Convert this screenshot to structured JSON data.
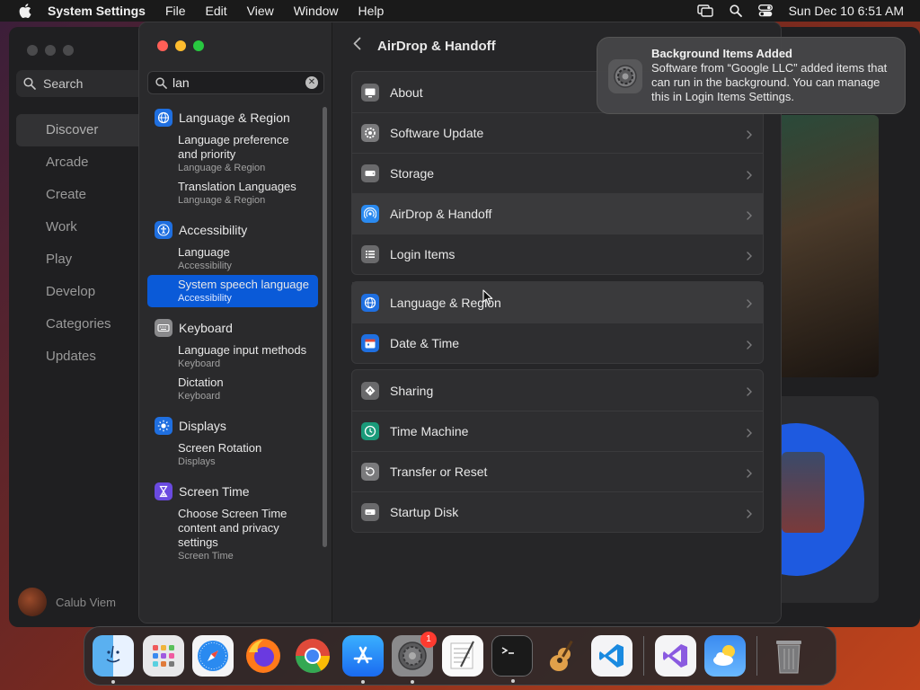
{
  "menubar": {
    "app_name": "System Settings",
    "items": [
      "File",
      "Edit",
      "View",
      "Window",
      "Help"
    ],
    "datetime": "Sun Dec 10  6:51 AM"
  },
  "bg_app": {
    "search_label": "Search",
    "nav": [
      "Discover",
      "Arcade",
      "Create",
      "Work",
      "Play",
      "Develop",
      "Categories",
      "Updates"
    ],
    "user_name": "Calub Viem"
  },
  "sidebar": {
    "search_value": "lan",
    "groups": [
      {
        "label": "Language & Region",
        "icon": "globe-icon",
        "color": "#1f6fe0",
        "subs": [
          {
            "title": "Language preference and priority",
            "source": "Language & Region"
          },
          {
            "title": "Translation Languages",
            "source": "Language & Region"
          }
        ]
      },
      {
        "label": "Accessibility",
        "icon": "accessibility-icon",
        "color": "#1f6fe0",
        "subs": [
          {
            "title": "Language",
            "source": "Accessibility"
          },
          {
            "title": "System speech language",
            "source": "Accessibility",
            "selected": true
          }
        ]
      },
      {
        "label": "Keyboard",
        "icon": "keyboard-icon",
        "color": "#8a8a8c",
        "subs": [
          {
            "title": "Language input methods",
            "source": "Keyboard"
          },
          {
            "title": "Dictation",
            "source": "Keyboard"
          }
        ]
      },
      {
        "label": "Displays",
        "icon": "sun-icon",
        "color": "#1f6fe0",
        "subs": [
          {
            "title": "Screen Rotation",
            "source": "Displays"
          }
        ]
      },
      {
        "label": "Screen Time",
        "icon": "hourglass-icon",
        "color": "#6a4ae0",
        "subs": [
          {
            "title": "Choose Screen Time content and privacy settings",
            "source": "Screen Time"
          }
        ]
      }
    ]
  },
  "main": {
    "title": "AirDrop & Handoff",
    "cards": [
      [
        {
          "label": "About",
          "icon": "display-icon"
        },
        {
          "label": "Software Update",
          "icon": "gear-icon"
        },
        {
          "label": "Storage",
          "icon": "storage-icon"
        },
        {
          "label": "AirDrop & Handoff",
          "icon": "airdrop-icon",
          "highlight": true
        },
        {
          "label": "Login Items",
          "icon": "list-icon"
        }
      ],
      [
        {
          "label": "Language & Region",
          "icon": "globe-icon",
          "highlight": true
        },
        {
          "label": "Date & Time",
          "icon": "calendar-icon"
        }
      ],
      [
        {
          "label": "Sharing",
          "icon": "sharing-icon"
        },
        {
          "label": "Time Machine",
          "icon": "time-machine-icon"
        },
        {
          "label": "Transfer or Reset",
          "icon": "reset-icon"
        },
        {
          "label": "Startup Disk",
          "icon": "disk-icon"
        }
      ]
    ]
  },
  "notification": {
    "title": "Background Items Added",
    "body": "Software from “Google LLC” added items that can run in the background. You can manage this in Login Items Settings."
  },
  "dock": {
    "badge_count": "1",
    "apps": [
      "finder",
      "launchpad",
      "safari",
      "firefox",
      "chrome",
      "app-store",
      "system-settings",
      "textedit",
      "terminal",
      "garageband",
      "vscode",
      "visual-studio",
      "weather",
      "trash"
    ]
  }
}
